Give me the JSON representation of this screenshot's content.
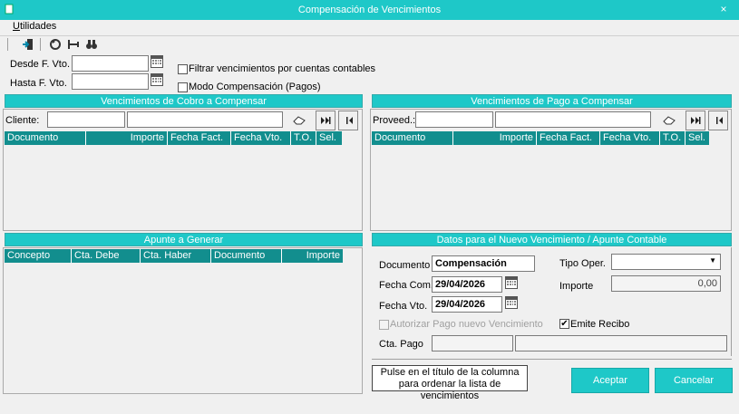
{
  "window": {
    "title": "Compensación de Vencimientos",
    "close_label": "×"
  },
  "menu": {
    "utilidades": "Utilidades"
  },
  "filters": {
    "desde_label": "Desde F. Vto.",
    "hasta_label": "Hasta F. Vto.",
    "desde_value": "",
    "hasta_value": "",
    "filtrar_label": "Filtrar vencimientos por cuentas contables",
    "modo_label": "Modo Compensación (Pagos)"
  },
  "cobro": {
    "title": "Vencimientos de Cobro a Compensar",
    "cliente_label": "Cliente:",
    "cliente_code": "",
    "cliente_name": "",
    "columns": [
      "Documento",
      "Importe",
      "Fecha Fact.",
      "Fecha Vto.",
      "T.O.",
      "Sel."
    ]
  },
  "pago": {
    "title": "Vencimientos de Pago a Compensar",
    "proveed_label": "Proveed.:",
    "proveed_code": "",
    "proveed_name": "",
    "columns": [
      "Documento",
      "Importe",
      "Fecha Fact.",
      "Fecha Vto.",
      "T.O.",
      "Sel."
    ]
  },
  "apunte": {
    "title": "Apunte a Generar",
    "columns": [
      "Concepto",
      "Cta. Debe",
      "Cta. Haber",
      "Documento",
      "Importe"
    ]
  },
  "datos": {
    "title": "Datos para el Nuevo Vencimiento / Apunte Contable",
    "documento_label": "Documento",
    "documento_value": "Compensación",
    "tipo_label": "Tipo Oper.",
    "tipo_value": "",
    "fecha_com_label": "Fecha Com.",
    "fecha_com_value": "29/04/2026",
    "importe_label": "Importe",
    "importe_value": "0,00",
    "fecha_vto_label": "Fecha Vto.",
    "fecha_vto_value": "29/04/2026",
    "autorizar_label": "Autorizar Pago nuevo Vencimiento",
    "emite_label": "Emite Recibo",
    "cta_pago_label": "Cta. Pago",
    "cta_pago_code": "",
    "cta_pago_name": ""
  },
  "footer": {
    "note": "Pulse en el título de la columna para ordenar la lista de vencimientos",
    "aceptar": "Aceptar",
    "cancelar": "Cancelar"
  },
  "colors": {
    "accent": "#1ec8c8",
    "grid_header": "#128e8e"
  }
}
